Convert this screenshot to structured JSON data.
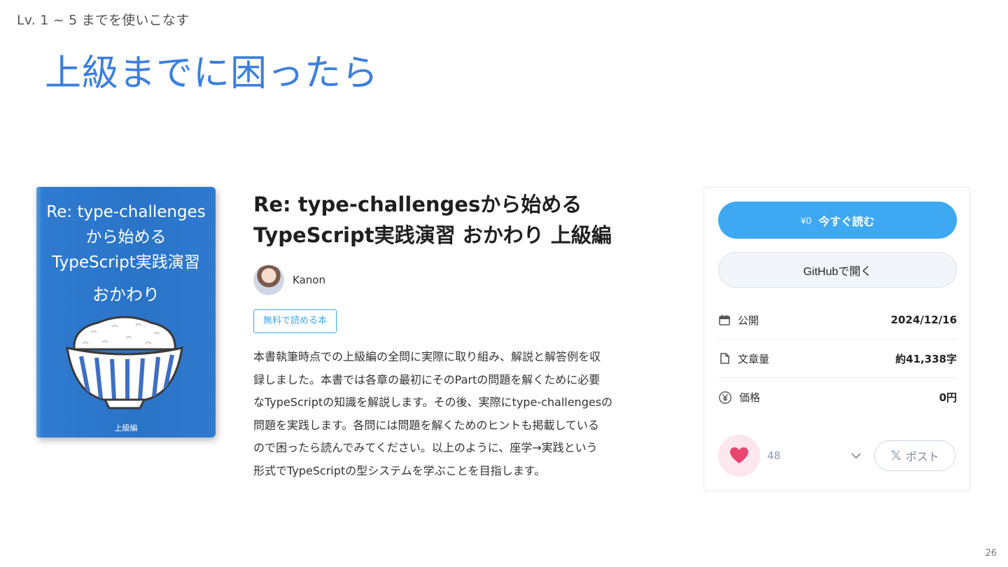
{
  "slide": {
    "breadcrumb": "Lv. 1 ~ 5 までを使いこなす",
    "title": "上級までに困ったら",
    "page_number": "26"
  },
  "cover": {
    "lines": [
      "Re: type-challenges",
      "から始める",
      "TypeScript実践演習"
    ],
    "subtitle": "おかわり",
    "footer": "上級編",
    "bowl_icon": "rice-bowl-icon"
  },
  "book": {
    "title_lines": [
      "Re: type-challengesから始める",
      "TypeScript実践演習 おかわり 上級編"
    ],
    "author": "Kanon",
    "badge": "無料で読める本",
    "description_lines": [
      "本書執筆時点での上級編の全問に実際に取り組み、解説と解答例を収",
      "録しました。本書では各章の最初にそのPartの問題を解くために必要",
      "なTypeScriptの知識を解説します。その後、実際にtype-challengesの",
      "問題を実践します。各問には問題を解くためのヒントも掲載している",
      "ので困ったら読んでみてください。以上のように、座学→実践という",
      "形式でTypeScriptの型システムを学ぶことを目指します。"
    ]
  },
  "panel": {
    "read_button": {
      "price": "¥0",
      "label": "今すぐ読む"
    },
    "github_button": "GitHubで開く",
    "meta": [
      {
        "icon": "calendar-icon",
        "label": "公開",
        "value": "2024/12/16"
      },
      {
        "icon": "document-icon",
        "label": "文章量",
        "value": "約41,338字"
      },
      {
        "icon": "yen-icon",
        "label": "価格",
        "value": "0円"
      }
    ],
    "likes": "48",
    "post_button": "ポスト"
  },
  "colors": {
    "title_blue": "#3b7fe0",
    "accent": "#3ea8f2",
    "heart": "#e8456f",
    "cover_blue": "#2a74c8"
  }
}
